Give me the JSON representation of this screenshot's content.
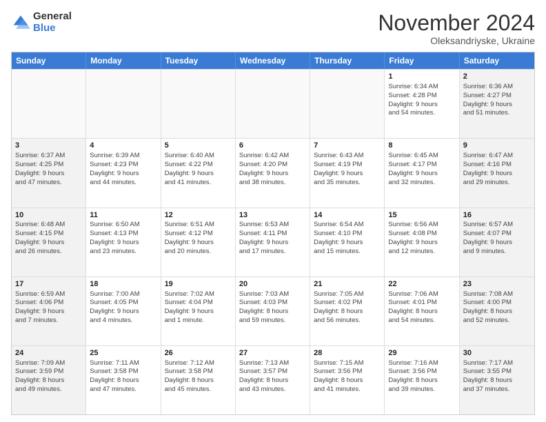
{
  "logo": {
    "general": "General",
    "blue": "Blue"
  },
  "header": {
    "month": "November 2024",
    "location": "Oleksandriyske, Ukraine"
  },
  "weekdays": [
    "Sunday",
    "Monday",
    "Tuesday",
    "Wednesday",
    "Thursday",
    "Friday",
    "Saturday"
  ],
  "weeks": [
    [
      {
        "day": "",
        "info": "",
        "empty": true
      },
      {
        "day": "",
        "info": "",
        "empty": true
      },
      {
        "day": "",
        "info": "",
        "empty": true
      },
      {
        "day": "",
        "info": "",
        "empty": true
      },
      {
        "day": "",
        "info": "",
        "empty": true
      },
      {
        "day": "1",
        "info": "Sunrise: 6:34 AM\nSunset: 4:28 PM\nDaylight: 9 hours\nand 54 minutes.",
        "empty": false
      },
      {
        "day": "2",
        "info": "Sunrise: 6:36 AM\nSunset: 4:27 PM\nDaylight: 9 hours\nand 51 minutes.",
        "empty": false,
        "shaded": true
      }
    ],
    [
      {
        "day": "3",
        "info": "Sunrise: 6:37 AM\nSunset: 4:25 PM\nDaylight: 9 hours\nand 47 minutes.",
        "empty": false,
        "shaded": true
      },
      {
        "day": "4",
        "info": "Sunrise: 6:39 AM\nSunset: 4:23 PM\nDaylight: 9 hours\nand 44 minutes.",
        "empty": false
      },
      {
        "day": "5",
        "info": "Sunrise: 6:40 AM\nSunset: 4:22 PM\nDaylight: 9 hours\nand 41 minutes.",
        "empty": false
      },
      {
        "day": "6",
        "info": "Sunrise: 6:42 AM\nSunset: 4:20 PM\nDaylight: 9 hours\nand 38 minutes.",
        "empty": false
      },
      {
        "day": "7",
        "info": "Sunrise: 6:43 AM\nSunset: 4:19 PM\nDaylight: 9 hours\nand 35 minutes.",
        "empty": false
      },
      {
        "day": "8",
        "info": "Sunrise: 6:45 AM\nSunset: 4:17 PM\nDaylight: 9 hours\nand 32 minutes.",
        "empty": false
      },
      {
        "day": "9",
        "info": "Sunrise: 6:47 AM\nSunset: 4:16 PM\nDaylight: 9 hours\nand 29 minutes.",
        "empty": false,
        "shaded": true
      }
    ],
    [
      {
        "day": "10",
        "info": "Sunrise: 6:48 AM\nSunset: 4:15 PM\nDaylight: 9 hours\nand 26 minutes.",
        "empty": false,
        "shaded": true
      },
      {
        "day": "11",
        "info": "Sunrise: 6:50 AM\nSunset: 4:13 PM\nDaylight: 9 hours\nand 23 minutes.",
        "empty": false
      },
      {
        "day": "12",
        "info": "Sunrise: 6:51 AM\nSunset: 4:12 PM\nDaylight: 9 hours\nand 20 minutes.",
        "empty": false
      },
      {
        "day": "13",
        "info": "Sunrise: 6:53 AM\nSunset: 4:11 PM\nDaylight: 9 hours\nand 17 minutes.",
        "empty": false
      },
      {
        "day": "14",
        "info": "Sunrise: 6:54 AM\nSunset: 4:10 PM\nDaylight: 9 hours\nand 15 minutes.",
        "empty": false
      },
      {
        "day": "15",
        "info": "Sunrise: 6:56 AM\nSunset: 4:08 PM\nDaylight: 9 hours\nand 12 minutes.",
        "empty": false
      },
      {
        "day": "16",
        "info": "Sunrise: 6:57 AM\nSunset: 4:07 PM\nDaylight: 9 hours\nand 9 minutes.",
        "empty": false,
        "shaded": true
      }
    ],
    [
      {
        "day": "17",
        "info": "Sunrise: 6:59 AM\nSunset: 4:06 PM\nDaylight: 9 hours\nand 7 minutes.",
        "empty": false,
        "shaded": true
      },
      {
        "day": "18",
        "info": "Sunrise: 7:00 AM\nSunset: 4:05 PM\nDaylight: 9 hours\nand 4 minutes.",
        "empty": false
      },
      {
        "day": "19",
        "info": "Sunrise: 7:02 AM\nSunset: 4:04 PM\nDaylight: 9 hours\nand 1 minute.",
        "empty": false
      },
      {
        "day": "20",
        "info": "Sunrise: 7:03 AM\nSunset: 4:03 PM\nDaylight: 8 hours\nand 59 minutes.",
        "empty": false
      },
      {
        "day": "21",
        "info": "Sunrise: 7:05 AM\nSunset: 4:02 PM\nDaylight: 8 hours\nand 56 minutes.",
        "empty": false
      },
      {
        "day": "22",
        "info": "Sunrise: 7:06 AM\nSunset: 4:01 PM\nDaylight: 8 hours\nand 54 minutes.",
        "empty": false
      },
      {
        "day": "23",
        "info": "Sunrise: 7:08 AM\nSunset: 4:00 PM\nDaylight: 8 hours\nand 52 minutes.",
        "empty": false,
        "shaded": true
      }
    ],
    [
      {
        "day": "24",
        "info": "Sunrise: 7:09 AM\nSunset: 3:59 PM\nDaylight: 8 hours\nand 49 minutes.",
        "empty": false,
        "shaded": true
      },
      {
        "day": "25",
        "info": "Sunrise: 7:11 AM\nSunset: 3:58 PM\nDaylight: 8 hours\nand 47 minutes.",
        "empty": false
      },
      {
        "day": "26",
        "info": "Sunrise: 7:12 AM\nSunset: 3:58 PM\nDaylight: 8 hours\nand 45 minutes.",
        "empty": false
      },
      {
        "day": "27",
        "info": "Sunrise: 7:13 AM\nSunset: 3:57 PM\nDaylight: 8 hours\nand 43 minutes.",
        "empty": false
      },
      {
        "day": "28",
        "info": "Sunrise: 7:15 AM\nSunset: 3:56 PM\nDaylight: 8 hours\nand 41 minutes.",
        "empty": false
      },
      {
        "day": "29",
        "info": "Sunrise: 7:16 AM\nSunset: 3:56 PM\nDaylight: 8 hours\nand 39 minutes.",
        "empty": false
      },
      {
        "day": "30",
        "info": "Sunrise: 7:17 AM\nSunset: 3:55 PM\nDaylight: 8 hours\nand 37 minutes.",
        "empty": false,
        "shaded": true
      }
    ]
  ]
}
